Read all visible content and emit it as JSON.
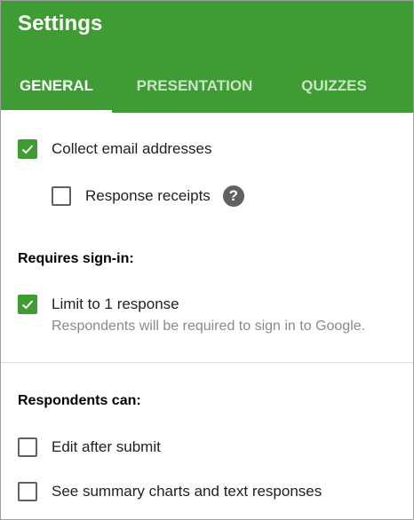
{
  "header": {
    "title": "Settings",
    "tabs": [
      {
        "label": "GENERAL",
        "active": true
      },
      {
        "label": "PRESENTATION",
        "active": false
      },
      {
        "label": "QUIZZES",
        "active": false
      }
    ]
  },
  "general": {
    "collect_email": {
      "label": "Collect email addresses",
      "checked": true
    },
    "response_receipts": {
      "label": "Response receipts",
      "checked": false
    },
    "help_icon": "?",
    "requires_signin_title": "Requires sign-in:",
    "limit_response": {
      "label": "Limit to 1 response",
      "checked": true
    },
    "limit_helper": "Respondents will be required to sign in to Google.",
    "respondents_can_title": "Respondents can:",
    "edit_after_submit": {
      "label": "Edit after submit",
      "checked": false
    },
    "see_summary": {
      "label": "See summary charts and text responses",
      "checked": false
    }
  },
  "colors": {
    "accent": "#3f9c35",
    "checkbox_border": "#616161",
    "helper_text": "#8a8a8a"
  }
}
